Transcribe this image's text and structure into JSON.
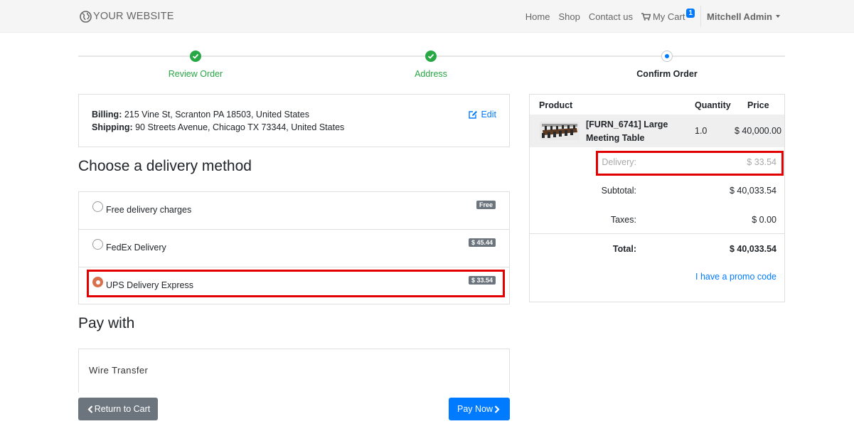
{
  "navbar": {
    "brand": "YOUR WEBSITE",
    "links": [
      "Home",
      "Shop",
      "Contact us"
    ],
    "cart_label": "My Cart",
    "cart_count": "1",
    "user": "Mitchell Admin"
  },
  "steps": [
    {
      "label": "Review Order",
      "status": "done"
    },
    {
      "label": "Address",
      "status": "done"
    },
    {
      "label": "Confirm Order",
      "status": "current"
    }
  ],
  "address": {
    "billing_label": "Billing:",
    "billing": "215 Vine St, Scranton PA 18503, United States",
    "shipping_label": "Shipping:",
    "shipping": "90 Streets Avenue, Chicago TX 73344, United States",
    "edit_label": "Edit"
  },
  "delivery": {
    "title": "Choose a delivery method",
    "carriers": [
      {
        "name": "Free delivery charges",
        "price": "Free",
        "selected": false
      },
      {
        "name": "FedEx Delivery",
        "price": "$ 45.44",
        "selected": false
      },
      {
        "name": "UPS Delivery Express",
        "price": "$ 33.54",
        "selected": true
      }
    ]
  },
  "payment": {
    "title": "Pay with",
    "method": "Wire Transfer"
  },
  "buttons": {
    "back": "Return to Cart",
    "pay": "Pay Now"
  },
  "summary": {
    "headers": {
      "product": "Product",
      "quantity": "Quantity",
      "price": "Price"
    },
    "product": {
      "name": "[FURN_6741] Large Meeting Table",
      "quantity": "1.0",
      "price": "$ 40,000.00"
    },
    "delivery_label": "Delivery:",
    "delivery_value": "$ 33.54",
    "subtotal_label": "Subtotal:",
    "subtotal_value": "$ 40,033.54",
    "taxes_label": "Taxes:",
    "taxes_value": "$ 0.00",
    "total_label": "Total:",
    "total_value": "$ 40,033.54",
    "promo": "I have a promo code"
  },
  "colors": {
    "success": "#28a745",
    "primary": "#007bff",
    "secondary": "#6c757d",
    "highlight": "#e30000",
    "radio_selected": "#d9704b"
  }
}
